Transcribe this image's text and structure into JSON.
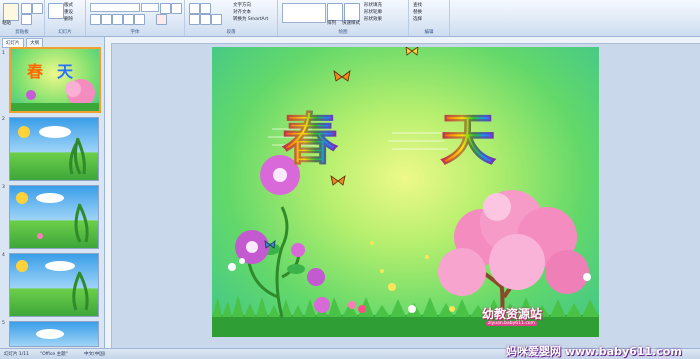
{
  "ribbon": {
    "groups": [
      {
        "label": "剪贴板"
      },
      {
        "label": "幻灯片"
      },
      {
        "label": "字体"
      },
      {
        "label": "段落"
      },
      {
        "label": "绘图"
      },
      {
        "label": "编辑"
      }
    ],
    "slides_items": [
      "版式",
      "重设",
      "删除"
    ],
    "paragraph_items": [
      "文字方向",
      "对齐文本",
      "转换为 SmartArt"
    ],
    "drawing_items": [
      "形状填充",
      "形状轮廓",
      "形状效果"
    ],
    "editing_items": [
      "查找",
      "替换",
      "选择"
    ],
    "paste_label": "粘贴",
    "new_slide_label": "新建幻灯片",
    "arrange_label": "排列",
    "quick_styles_label": "快速样式"
  },
  "panel": {
    "tabs": [
      "幻灯片",
      "大纲"
    ],
    "thumbnails": [
      {
        "num": "1",
        "selected": true
      },
      {
        "num": "2",
        "selected": false
      },
      {
        "num": "3",
        "selected": false
      },
      {
        "num": "4",
        "selected": false
      },
      {
        "num": "5",
        "selected": false
      }
    ]
  },
  "slide": {
    "title_chars": [
      "春",
      "天"
    ],
    "logo": "幼教资源站",
    "logo_url": "ziyuan.baby611.com"
  },
  "status": {
    "slide_info": "幻灯片 1/11",
    "theme": "\"Office 主题\"",
    "language": "中文(中国)"
  },
  "watermark": "妈咪爱婴网 www.baby611.com",
  "colors": {
    "ribbon_bg": "#dfe9f6",
    "selection": "#f0a030",
    "slide_bg": "#63d86a"
  }
}
